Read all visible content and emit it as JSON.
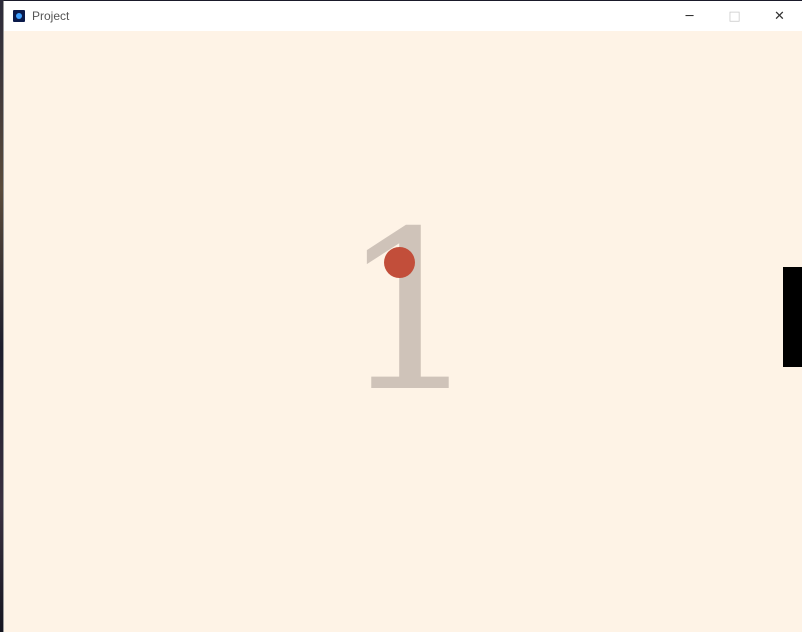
{
  "window": {
    "title": "Project",
    "icon": "app-icon",
    "controls": {
      "minimize_glyph": "─",
      "maximize_glyph": "□",
      "close_glyph": "✕"
    }
  },
  "game": {
    "score": "1",
    "colors": {
      "background": "#fef3e6",
      "score_text": "#cfc3b9",
      "ball": "#c24e3a",
      "paddle": "#000000"
    }
  }
}
